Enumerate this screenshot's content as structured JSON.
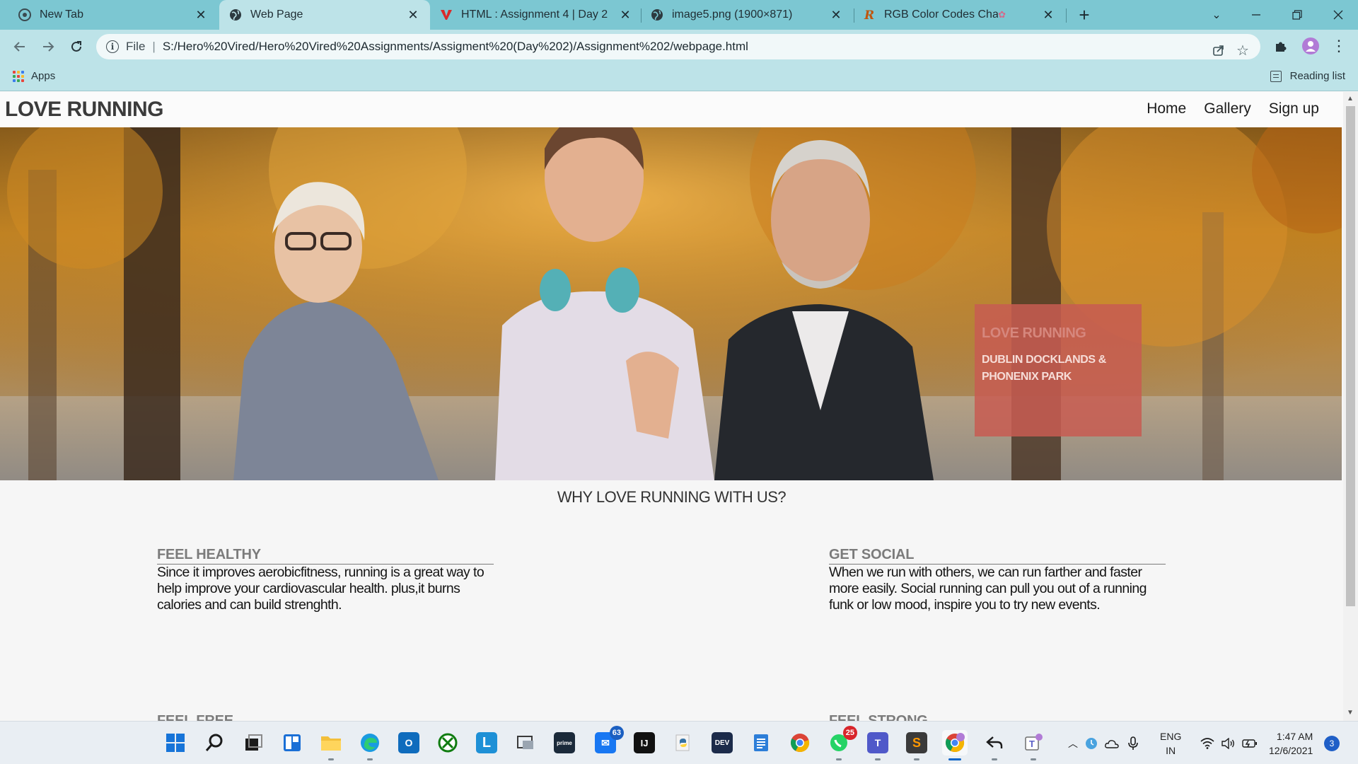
{
  "browser": {
    "tabs": [
      {
        "title": "New Tab",
        "icon": "chrome-icon",
        "active": false
      },
      {
        "title": "Web Page",
        "icon": "globe-icon",
        "active": true
      },
      {
        "title": "HTML : Assignment 4 | Day 2",
        "icon": "v-logo-icon",
        "active": false
      },
      {
        "title": "image5.png (1900×871)",
        "icon": "globe-icon",
        "active": false
      },
      {
        "title": "RGB Color Codes Chart",
        "icon": "r-logo-icon",
        "active": false
      }
    ],
    "new_tab_label": "+",
    "address": {
      "scheme": "File",
      "url": "S:/Hero%20Vired/Hero%20Vired%20Assignments/Assigment%20(Day%202)/Assignment%202/webpage.html"
    },
    "bookmarks": {
      "apps_label": "Apps",
      "reading_list_label": "Reading list"
    },
    "colors": {
      "tabstrip": "#7cc7d2",
      "toolbar": "#bde3e8"
    }
  },
  "page": {
    "logo": "LOVE RUNNING",
    "nav": [
      "Home",
      "Gallery",
      "Sign up"
    ],
    "hero": {
      "box_title": "LOVE RUNNING",
      "box_subtitle": "DUBLIN DOCKLANDS & PHONENIX PARK",
      "box_color": "#c75c52"
    },
    "section_title": "WHY LOVE RUNNING WITH US?",
    "features": [
      {
        "heading": "FEEL HEALTHY",
        "text": "Since it improves aerobicfitness, running is a great way to help improve your cardiovascular health. plus,it burns calories and can build strenghth."
      },
      {
        "heading": "GET SOCIAL",
        "text": "When we run with others, we can run farther and faster more easily. Social running can pull you out of a running funk or low mood, inspire you to try new events."
      },
      {
        "heading": "FEEL FREE",
        "text": ""
      },
      {
        "heading": "FEEL STRONG",
        "text": ""
      }
    ]
  },
  "taskbar": {
    "apps": [
      {
        "name": "windows-start-icon"
      },
      {
        "name": "search-icon"
      },
      {
        "name": "task-view-icon"
      },
      {
        "name": "widgets-icon"
      },
      {
        "name": "file-explorer-icon"
      },
      {
        "name": "edge-icon"
      },
      {
        "name": "outlook-icon"
      },
      {
        "name": "xbox-icon"
      },
      {
        "name": "l-app-icon"
      },
      {
        "name": "snipping-tool-icon"
      },
      {
        "name": "prime-video-icon"
      },
      {
        "name": "messenger-icon",
        "badge": "63"
      },
      {
        "name": "intellij-icon"
      },
      {
        "name": "python-icon"
      },
      {
        "name": "dev-icon"
      },
      {
        "name": "notepad-icon"
      },
      {
        "name": "chrome-icon"
      },
      {
        "name": "whatsapp-icon",
        "badge": "25"
      },
      {
        "name": "teams-icon"
      },
      {
        "name": "sublime-icon"
      },
      {
        "name": "chrome-profile-icon"
      },
      {
        "name": "reply-arrow-icon"
      },
      {
        "name": "teams-personal-icon"
      }
    ],
    "tray": {
      "language_line1": "ENG",
      "language_line2": "IN",
      "time": "1:47 AM",
      "date": "12/6/2021",
      "notification_count": "3"
    }
  }
}
